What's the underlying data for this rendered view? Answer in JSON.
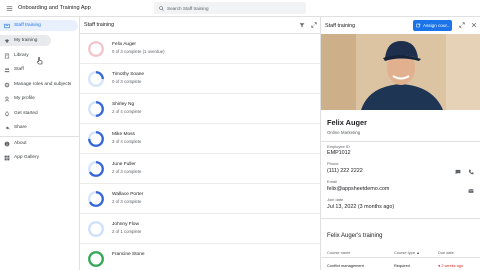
{
  "app": {
    "title": "Onboarding and Training App"
  },
  "search": {
    "placeholder": "Search Staff training"
  },
  "sidebar": {
    "items": [
      {
        "label": "Staff training",
        "icon": "training-icon"
      },
      {
        "label": "My training",
        "icon": "school-icon"
      },
      {
        "label": "Library",
        "icon": "library-icon"
      },
      {
        "label": "Staff",
        "icon": "people-icon"
      },
      {
        "label": "Manage roles and subjects",
        "icon": "settings-icon"
      },
      {
        "label": "My profile",
        "icon": "person-icon"
      },
      {
        "label": "Get started",
        "icon": "rocket-icon"
      },
      {
        "label": "Share",
        "icon": "share-icon"
      },
      {
        "label": "About",
        "icon": "info-icon"
      },
      {
        "label": "App Gallery",
        "icon": "grid-icon"
      }
    ]
  },
  "list": {
    "title": "Staff training",
    "rows": [
      {
        "name": "Felix Auger",
        "status": "0 of 3 complete (1 overdue)",
        "progress": 0,
        "color": "#f2c4c9"
      },
      {
        "name": "Timothy Soane",
        "status": "0 of 3 complete",
        "progress": 0.25,
        "color": "#3367d6"
      },
      {
        "name": "Shirley Ng",
        "status": "2 of 4 complete",
        "progress": 0.5,
        "color": "#3367d6"
      },
      {
        "name": "Mike Moss",
        "status": "3 of 4 complete",
        "progress": 0.75,
        "color": "#3367d6"
      },
      {
        "name": "June Fuller",
        "status": "2 of 3 complete",
        "progress": 0.67,
        "color": "#3367d6"
      },
      {
        "name": "Wallace Porter",
        "status": "2 of 3 complete",
        "progress": 0.67,
        "color": "#3367d6"
      },
      {
        "name": "Johnny Flow",
        "status": "2 of 1 complete",
        "progress": 0,
        "color": "#cfe0fb"
      },
      {
        "name": "Francine Stone",
        "status": "",
        "progress": 1,
        "color": "#34a853"
      }
    ]
  },
  "detail": {
    "title": "Staff training",
    "assign_label": "Assign cour...",
    "name": "Felix Auger",
    "role": "Online Marketing",
    "employee_id_label": "Employee ID",
    "employee_id": "EMP1012",
    "phone_label": "Phone",
    "phone": "(111) 222 2222",
    "email_label": "Email",
    "email": "felix@appsheetdemo.com",
    "join_label": "Join date",
    "join_date": "Jul 13, 2022 (3 months ago)",
    "training_title": "Felix Auger's training",
    "table": {
      "headers": [
        "Course name",
        "Course type",
        "Due date"
      ],
      "row": [
        "Conflict management",
        "Required",
        "2 weeks ago"
      ]
    }
  }
}
